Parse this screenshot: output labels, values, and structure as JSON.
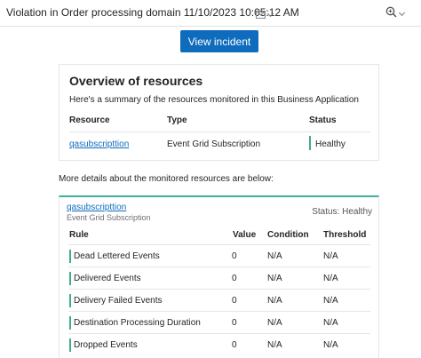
{
  "header": {
    "subject": "Violation in Order processing domain 11/10/2023 10:05:12 AM",
    "envelope_icon": "envelope-icon",
    "zoom_icon": "zoom-icon"
  },
  "actions": {
    "view_incident": "View incident"
  },
  "overview": {
    "title": "Overview of resources",
    "description": "Here's a summary of the resources monitored in this Business Application",
    "columns": [
      "Resource",
      "Type",
      "Status"
    ],
    "rows": [
      {
        "resource": "qasubscripttion",
        "type": "Event Grid Subscription",
        "status": "Healthy"
      }
    ]
  },
  "more_details": "More details about the monitored resources are below:",
  "detail": {
    "resource_link": "qasubscripttion",
    "resource_type": "Event Grid Subscription",
    "status": "Status: Healthy",
    "columns": [
      "Rule",
      "Value",
      "Condition",
      "Threshold"
    ],
    "rows": [
      {
        "rule": "Dead Lettered Events",
        "value": "0",
        "condition": "N/A",
        "threshold": "N/A"
      },
      {
        "rule": "Delivered Events",
        "value": "0",
        "condition": "N/A",
        "threshold": "N/A"
      },
      {
        "rule": "Delivery Failed Events",
        "value": "0",
        "condition": "N/A",
        "threshold": "N/A"
      },
      {
        "rule": "Destination Processing Duration",
        "value": "0",
        "condition": "N/A",
        "threshold": "N/A"
      },
      {
        "rule": "Dropped Events",
        "value": "0",
        "condition": "N/A",
        "threshold": "N/A"
      }
    ]
  },
  "colors": {
    "accent": "#0f6cbd",
    "healthy": "#3fae7e",
    "detail_border": "#3fae9a"
  }
}
